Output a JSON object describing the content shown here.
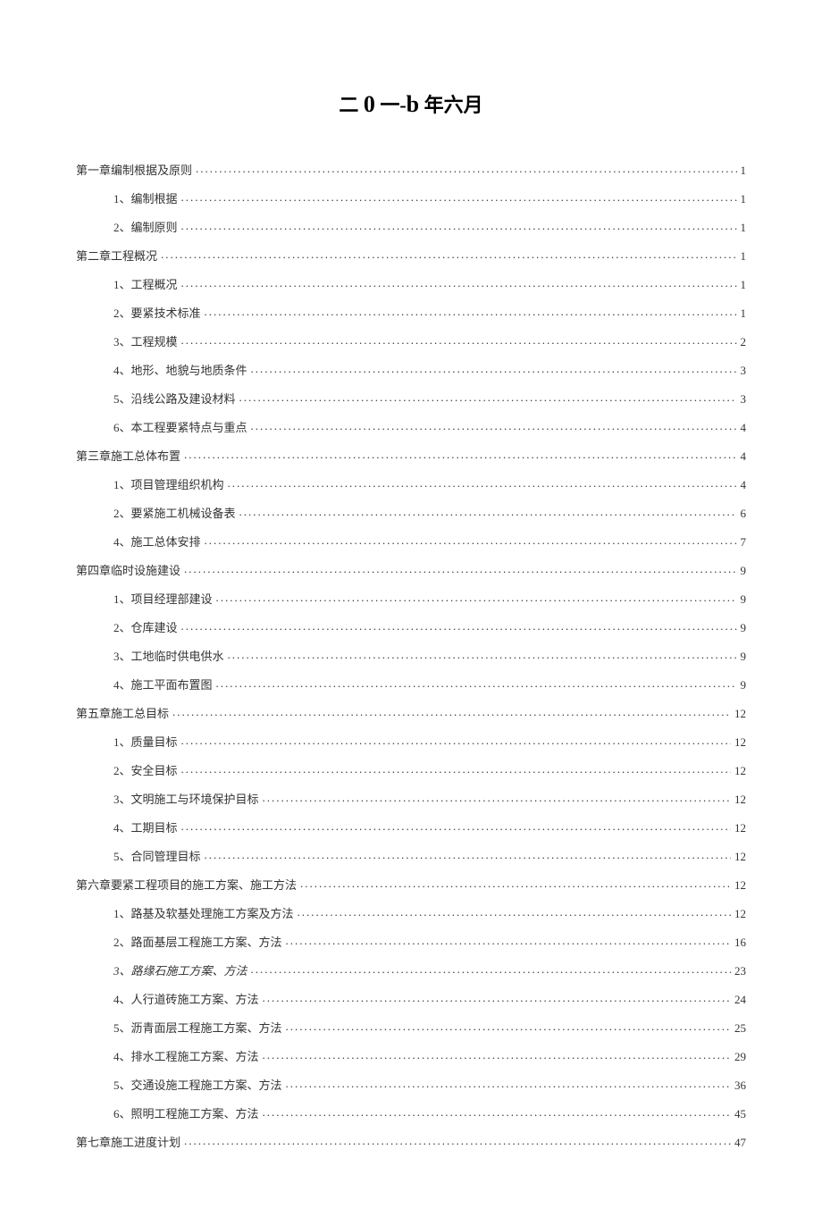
{
  "title_prefix": "二",
  "title_big1": "0",
  "title_mid": "一-",
  "title_big2": "b",
  "title_suffix": "年六月",
  "toc": [
    {
      "level": 1,
      "label": "第一章编制根据及原则",
      "page": "1"
    },
    {
      "level": 2,
      "label": "1、编制根据",
      "page": "1"
    },
    {
      "level": 2,
      "label": "2、编制原则",
      "page": "1"
    },
    {
      "level": 1,
      "label": "第二章工程概况",
      "page": "1"
    },
    {
      "level": 2,
      "label": "1、工程概况",
      "page": "1"
    },
    {
      "level": 2,
      "label": "2、要紧技术标准",
      "page": "1"
    },
    {
      "level": 2,
      "label": "3、工程规模",
      "page": "2"
    },
    {
      "level": 2,
      "label": "4、地形、地貌与地质条件",
      "page": "3"
    },
    {
      "level": 2,
      "label": "5、沿线公路及建设材料",
      "page": "3"
    },
    {
      "level": 2,
      "label": "6、本工程要紧特点与重点",
      "page": "4"
    },
    {
      "level": 1,
      "label": "第三章施工总体布置",
      "page": "4"
    },
    {
      "level": 2,
      "label": "1、项目管理组织机构",
      "page": "4"
    },
    {
      "level": 2,
      "label": "2、要紧施工机械设备表",
      "page": "6"
    },
    {
      "level": 2,
      "label": "4、施工总体安排",
      "page": "7"
    },
    {
      "level": 1,
      "label": "第四章临时设施建设",
      "page": "9"
    },
    {
      "level": 2,
      "label": "1、项目经理部建设",
      "page": "9"
    },
    {
      "level": 2,
      "label": "2、仓库建设",
      "page": "9"
    },
    {
      "level": 2,
      "label": "3、工地临时供电供水",
      "page": "9"
    },
    {
      "level": 2,
      "label": "4、施工平面布置图",
      "page": "9"
    },
    {
      "level": 1,
      "label": "第五章施工总目标",
      "page": "12"
    },
    {
      "level": 2,
      "label": "1、质量目标",
      "page": "12"
    },
    {
      "level": 2,
      "label": "2、安全目标",
      "page": "12"
    },
    {
      "level": 2,
      "label": "3、文明施工与环境保护目标",
      "page": "12"
    },
    {
      "level": 2,
      "label": "4、工期目标",
      "page": "12"
    },
    {
      "level": 2,
      "label": "5、合同管理目标",
      "page": "12"
    },
    {
      "level": 1,
      "label": "第六章要紧工程项目的施工方案、施工方法",
      "page": "12"
    },
    {
      "level": 2,
      "label": "1、路基及软基处理施工方案及方法",
      "page": "12"
    },
    {
      "level": 2,
      "label": "2、路面基层工程施工方案、方法",
      "page": "16"
    },
    {
      "level": 2,
      "label": "3、路缘石施工方案、方法",
      "page": "23",
      "italic": true
    },
    {
      "level": 2,
      "label": "4、人行道砖施工方案、方法",
      "page": "24"
    },
    {
      "level": 2,
      "label": "5、沥青面层工程施工方案、方法",
      "page": "25"
    },
    {
      "level": 2,
      "label": "4、排水工程施工方案、方法",
      "page": "29"
    },
    {
      "level": 2,
      "label": "5、交通设施工程施工方案、方法",
      "page": "36"
    },
    {
      "level": 2,
      "label": "6、照明工程施工方案、方法",
      "page": "45"
    },
    {
      "level": 1,
      "label": "第七章施工进度计划",
      "page": "47"
    }
  ]
}
